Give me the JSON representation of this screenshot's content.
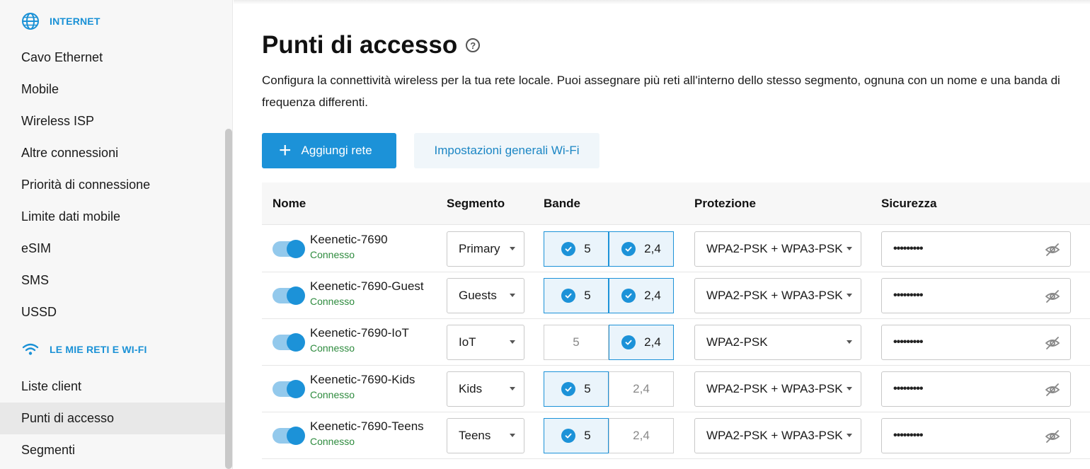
{
  "sidebar": {
    "section_internet": "INTERNET",
    "section_networks": "LE MIE RETI E WI-FI",
    "internet_items": [
      "Cavo Ethernet",
      "Mobile",
      "Wireless ISP",
      "Altre connessioni",
      "Priorità di connessione",
      "Limite dati mobile",
      "eSIM",
      "SMS",
      "USSD"
    ],
    "network_items": [
      "Liste client",
      "Punti di accesso",
      "Segmenti"
    ],
    "active_item": "Punti di accesso"
  },
  "page": {
    "title": "Punti di accesso",
    "help": "?",
    "description": "Configura la connettività wireless per la tua rete locale. Puoi assegnare più reti all'interno dello stesso segmento, ognuna con un nome e una banda di frequenza differenti."
  },
  "actions": {
    "add_plus": "+",
    "add_label": "Aggiungi rete",
    "wifi_settings_label": "Impostazioni generali Wi-Fi"
  },
  "table": {
    "headers": {
      "name": "Nome",
      "segment": "Segmento",
      "bands": "Bande",
      "protection": "Protezione",
      "security": "Sicurezza"
    },
    "rows": [
      {
        "enabled": true,
        "ssid": "Keenetic-7690",
        "status": "Connesso",
        "segment": "Primary",
        "band5_label": "5",
        "band5_on": true,
        "band24_label": "2,4",
        "band24_on": true,
        "protection": "WPA2-PSK + WPA3-PSK",
        "password": "•••••••••"
      },
      {
        "enabled": true,
        "ssid": "Keenetic-7690-Guest",
        "status": "Connesso",
        "segment": "Guests",
        "band5_label": "5",
        "band5_on": true,
        "band24_label": "2,4",
        "band24_on": true,
        "protection": "WPA2-PSK + WPA3-PSK",
        "password": "•••••••••"
      },
      {
        "enabled": true,
        "ssid": "Keenetic-7690-IoT",
        "status": "Connesso",
        "segment": "IoT",
        "band5_label": "5",
        "band5_on": false,
        "band24_label": "2,4",
        "band24_on": true,
        "protection": "WPA2-PSK",
        "password": "•••••••••"
      },
      {
        "enabled": true,
        "ssid": "Keenetic-7690-Kids",
        "status": "Connesso",
        "segment": "Kids",
        "band5_label": "5",
        "band5_on": true,
        "band24_label": "2,4",
        "band24_on": false,
        "protection": "WPA2-PSK + WPA3-PSK",
        "password": "•••••••••"
      },
      {
        "enabled": true,
        "ssid": "Keenetic-7690-Teens",
        "status": "Connesso",
        "segment": "Teens",
        "band5_label": "5",
        "band5_on": true,
        "band24_label": "2,4",
        "band24_on": false,
        "protection": "WPA2-PSK + WPA3-PSK",
        "password": "•••••••••"
      }
    ]
  },
  "colors": {
    "accent": "#1c92d8",
    "status_ok": "#2e8b3e"
  }
}
